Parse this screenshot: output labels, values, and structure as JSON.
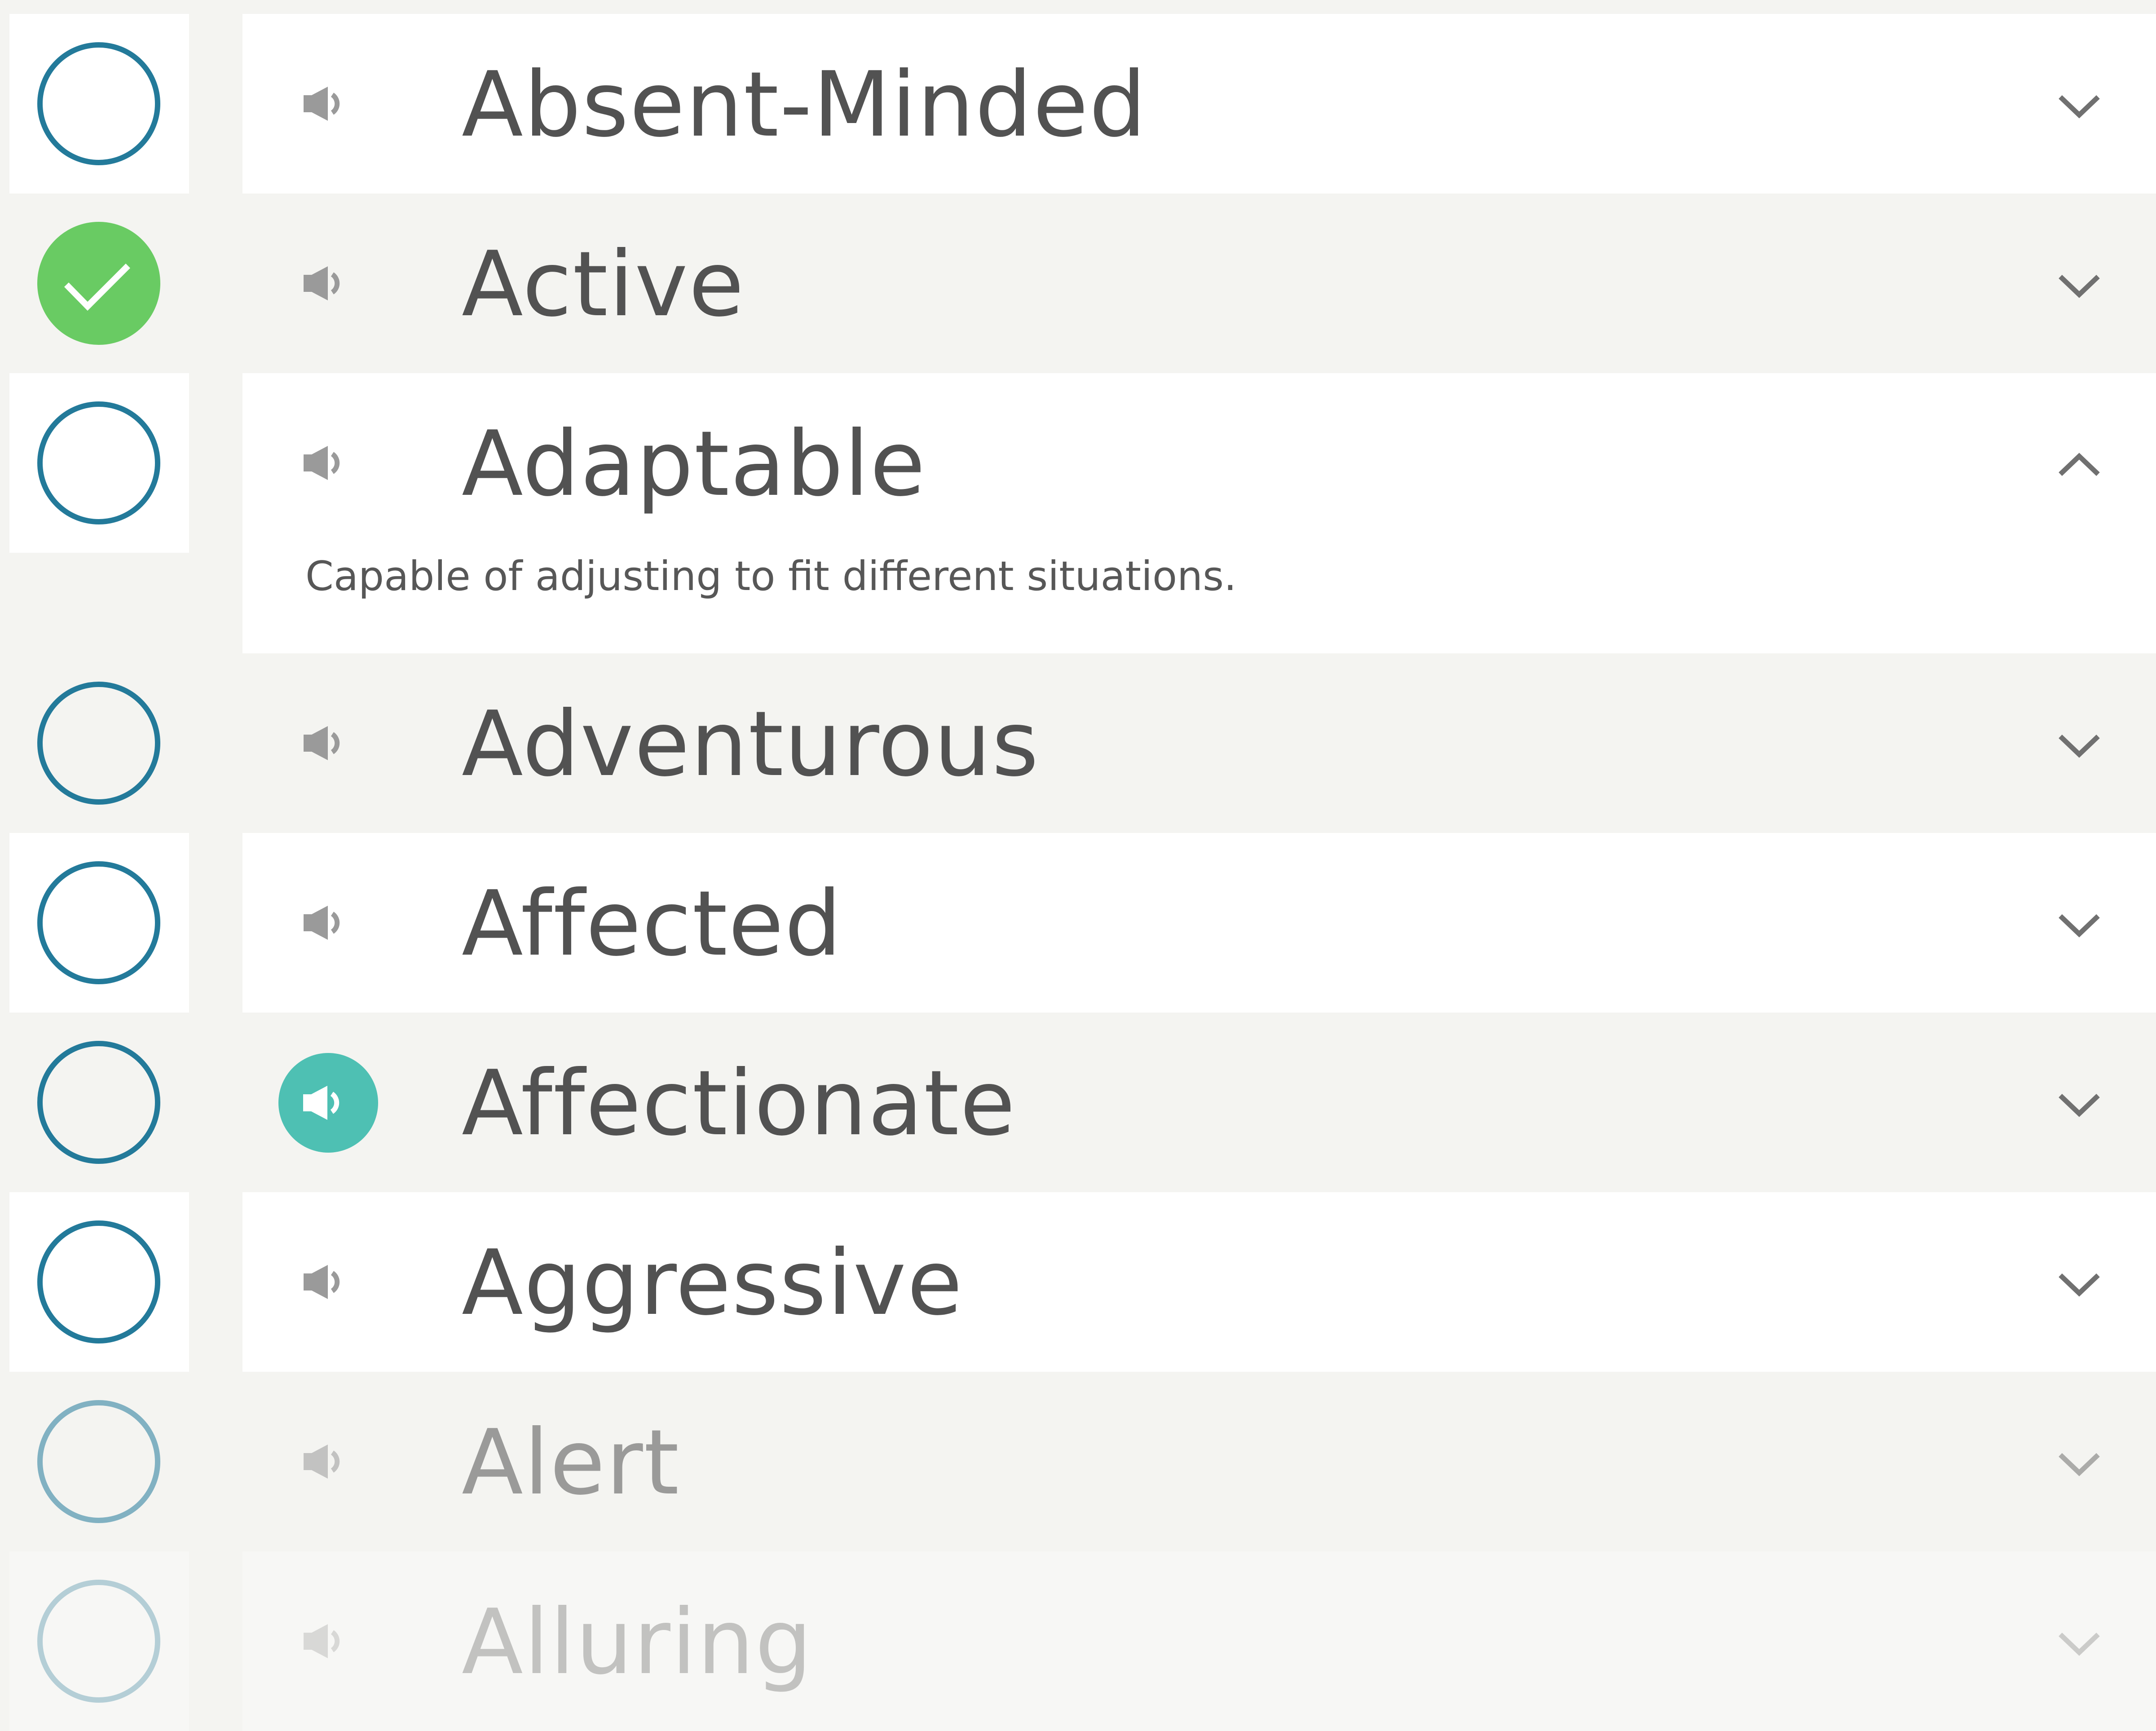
{
  "list": {
    "items": [
      {
        "word": "Absent-Minded",
        "checked": false,
        "expanded": false,
        "audio_active": false,
        "opacity": 1
      },
      {
        "word": "Active",
        "checked": true,
        "expanded": false,
        "audio_active": false,
        "opacity": 1
      },
      {
        "word": "Adaptable",
        "checked": false,
        "expanded": true,
        "audio_active": false,
        "opacity": 1,
        "definition": "Capable of adjusting to fit different situations."
      },
      {
        "word": "Adventurous",
        "checked": false,
        "expanded": false,
        "audio_active": false,
        "opacity": 1
      },
      {
        "word": "Affected",
        "checked": false,
        "expanded": false,
        "audio_active": false,
        "opacity": 1
      },
      {
        "word": "Affectionate",
        "checked": false,
        "expanded": false,
        "audio_active": true,
        "opacity": 1
      },
      {
        "word": "Aggressive",
        "checked": false,
        "expanded": false,
        "audio_active": false,
        "opacity": 1
      },
      {
        "word": "Alert",
        "checked": false,
        "expanded": false,
        "audio_active": false,
        "opacity": 0.55
      },
      {
        "word": "Alluring",
        "checked": false,
        "expanded": false,
        "audio_active": false,
        "opacity": 0.3
      }
    ]
  },
  "icons": {
    "speaker": "speaker-icon",
    "checkmark": "checkmark-icon",
    "chevron_down": "chevron-down-icon",
    "chevron_up": "chevron-up-icon"
  },
  "colors": {
    "ring": "#237a9a",
    "checked": "#69cb63",
    "audio_active": "#4ec0b3",
    "text": "#525252",
    "row_white": "#ffffff",
    "row_gray": "#f4f4f1"
  }
}
